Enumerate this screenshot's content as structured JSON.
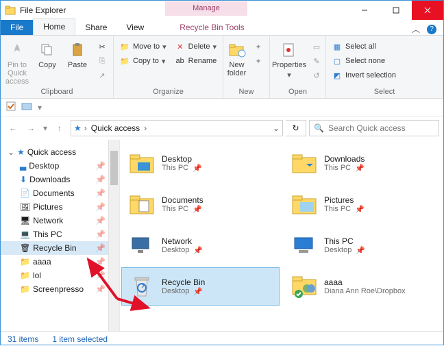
{
  "window": {
    "title": "File Explorer"
  },
  "manage": {
    "heading": "Manage",
    "context_tab": "Recycle Bin Tools"
  },
  "tabs": {
    "file": "File",
    "home": "Home",
    "share": "Share",
    "view": "View"
  },
  "ribbon": {
    "pin": "Pin to Quick access",
    "copy": "Copy",
    "paste": "Paste",
    "cut": "Cut",
    "copypath": "Copy path",
    "pasteshort": "Paste shortcut",
    "moveto": "Move to",
    "copyto": "Copy to",
    "delete": "Delete",
    "rename": "Rename",
    "newfolder": "New folder",
    "newitem": "New item",
    "easy": "Easy access",
    "properties": "Properties",
    "open": "Open",
    "edit": "Edit",
    "history": "History",
    "selectall": "Select all",
    "selectnone": "Select none",
    "invert": "Invert selection",
    "groups": {
      "clipboard": "Clipboard",
      "organize": "Organize",
      "new": "New",
      "open": "Open",
      "select": "Select"
    }
  },
  "address": {
    "root": "Quick access",
    "chev": "›"
  },
  "search": {
    "placeholder": "Search Quick access"
  },
  "sidebar": {
    "quick": "Quick access",
    "items": [
      {
        "label": "Desktop"
      },
      {
        "label": "Downloads"
      },
      {
        "label": "Documents"
      },
      {
        "label": "Pictures"
      },
      {
        "label": "Network"
      },
      {
        "label": "This PC"
      },
      {
        "label": "Recycle Bin"
      },
      {
        "label": "aaaa"
      },
      {
        "label": "lol"
      },
      {
        "label": "Screenpresso"
      }
    ]
  },
  "content": {
    "items": [
      {
        "name": "Desktop",
        "sub": "This PC"
      },
      {
        "name": "Downloads",
        "sub": "This PC"
      },
      {
        "name": "Documents",
        "sub": "This PC"
      },
      {
        "name": "Pictures",
        "sub": "This PC"
      },
      {
        "name": "Network",
        "sub": "Desktop"
      },
      {
        "name": "This PC",
        "sub": "Desktop"
      },
      {
        "name": "Recycle Bin",
        "sub": "Desktop"
      },
      {
        "name": "aaaa",
        "sub": "Diana Ann Roe\\Dropbox"
      }
    ]
  },
  "status": {
    "count": "31 items",
    "selected": "1 item selected"
  }
}
